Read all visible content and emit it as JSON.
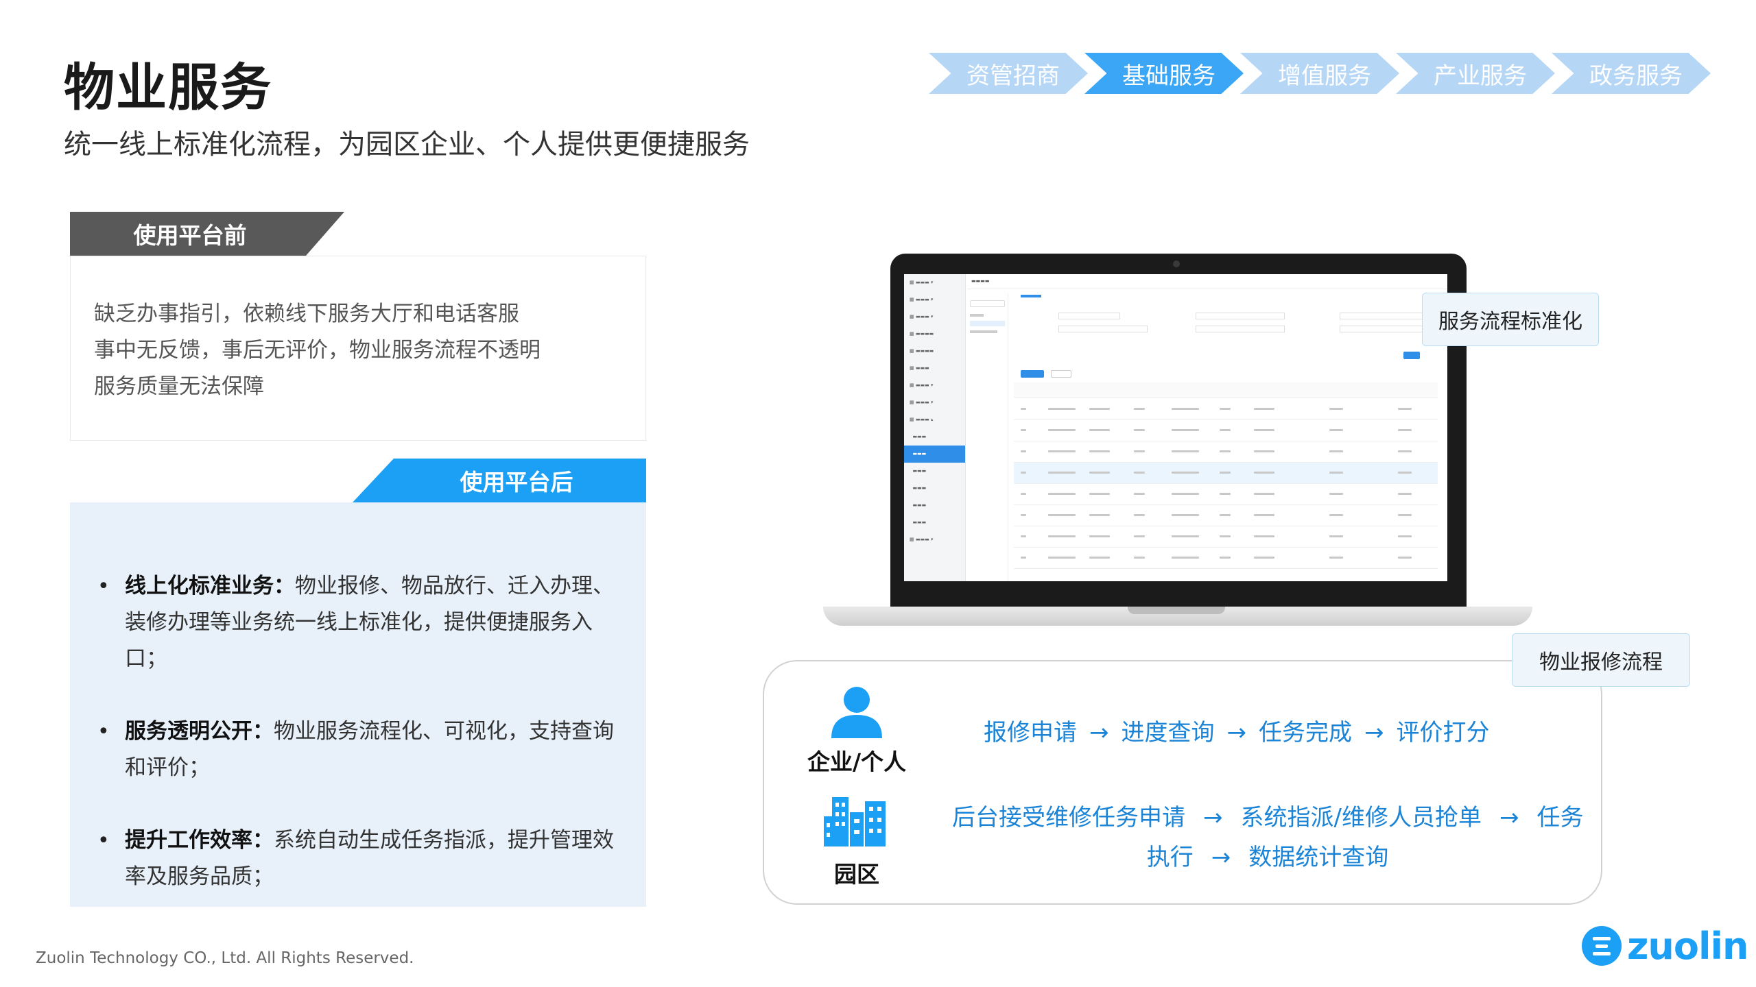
{
  "page": {
    "title": "物业服务",
    "subtitle": "统一线上标准化流程，为园区企业、个人提供更便捷服务"
  },
  "nav": {
    "items": [
      "资管招商",
      "基础服务",
      "增值服务",
      "产业服务",
      "政务服务"
    ],
    "active_index": 1,
    "active_color": "#3aa6f5",
    "inactive_color": "#b5d6f5"
  },
  "before": {
    "label": "使用平台前",
    "lines": [
      "缺乏办事指引，依赖线下服务大厅和电话客服",
      "事中无反馈，事后无评价，物业服务流程不透明",
      "服务质量无法保障"
    ]
  },
  "after": {
    "label": "使用平台后",
    "bullets": [
      {
        "head": "线上化标准业务：",
        "text": "物业报修、物品放行、迁入办理、装修办理等业务统一线上标准化，提供便捷服务入口；"
      },
      {
        "head": "服务透明公开：",
        "text": "物业服务流程化、可视化，支持查询和评价；"
      },
      {
        "head": "提升工作效率：",
        "text": "系统自动生成任务指派，提升管理效率及服务品质；"
      }
    ]
  },
  "tags": {
    "standardization": "服务流程标准化",
    "repair_flow": "物业报修流程"
  },
  "flow": {
    "person_label": "企业/个人",
    "park_label": "园区",
    "person_steps": [
      "报修申请",
      "进度查询",
      "任务完成",
      "评价打分"
    ],
    "park_line1": [
      "后台接受维修任务申请",
      "系统指派/维修人员抢单",
      "任务"
    ],
    "park_line2": [
      "执行",
      "数据统计查询"
    ],
    "arrow": "→"
  },
  "footer": {
    "copyright": "Zuolin Technology CO., Ltd. All Rights Reserved.",
    "logo_text": "zuolin"
  },
  "colors": {
    "brand": "#1ba0f5",
    "flow_text": "#1c84d6"
  }
}
